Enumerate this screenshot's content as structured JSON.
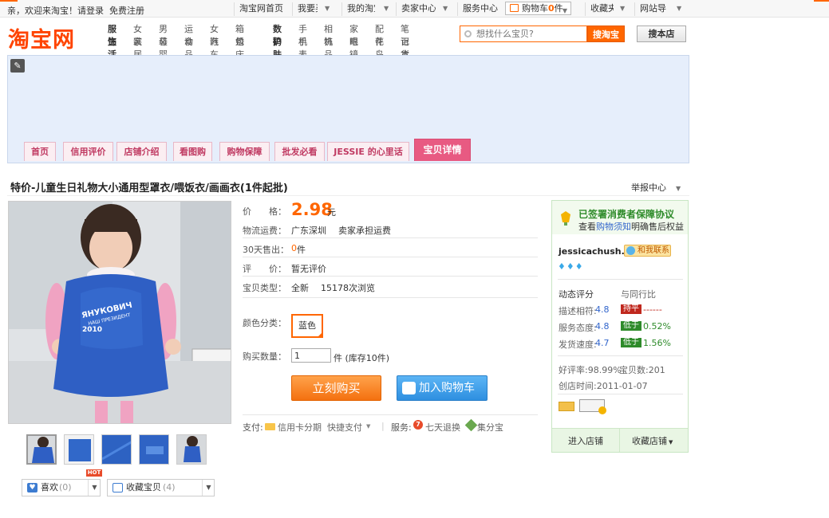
{
  "topbar": {
    "welcome": "亲，欢迎来淘宝！请",
    "login": "登录",
    "register": "免费注册",
    "items": [
      {
        "label": "淘宝网首页"
      },
      {
        "label": "我要买"
      },
      {
        "label": "我的淘宝"
      },
      {
        "label": "卖家中心"
      },
      {
        "label": "服务中心"
      },
      {
        "label": "收藏夹"
      },
      {
        "label": "网站导航"
      }
    ],
    "cart_label": "购物车",
    "cart_count": "0",
    "cart_unit": "件"
  },
  "header": {
    "logo": "淘宝网",
    "categories": {
      "col1_bold": [
        "服饰",
        "生活"
      ],
      "col_a": [
        "女装",
        "家居"
      ],
      "col_b": [
        "男装",
        "母婴"
      ],
      "col_c": [
        "运动",
        "食品"
      ],
      "col_d": [
        "女鞋",
        "汽车"
      ],
      "col_e": [
        "箱包",
        "婚庆"
      ],
      "col2_bold": [
        "数码",
        "护肤"
      ],
      "col_f": [
        "手机",
        "手表"
      ],
      "col_g": [
        "相机",
        "饰品"
      ],
      "col_h": [
        "家电",
        "眼镜"
      ],
      "col_i": [
        "配件",
        "花鸟"
      ],
      "col_j": [
        "笔记本",
        "百货"
      ]
    },
    "search_placeholder": "想找什么宝贝?",
    "search_taobao": "搜淘宝",
    "search_store": "搜本店"
  },
  "nav": {
    "tabs": [
      "首页",
      "信用评价",
      "店铺介绍",
      "看图购",
      "购物保障",
      "批发必看",
      "JESSIE 的心里话"
    ],
    "active": "宝贝详情"
  },
  "item": {
    "title": "特价-儿童生日礼物大小通用型罩衣/喂饭衣/画画衣(1件起批)",
    "report": "举报中心",
    "price_label": "价　　格：",
    "price": "2.98",
    "price_unit": "元",
    "shipping_label": "物流运费：",
    "shipping_from": "广东深圳",
    "shipping_note": "卖家承担运费",
    "sold_label": "30天售出：",
    "sold_count": "0",
    "sold_unit": "件",
    "rating_label": "评　　价：",
    "rating_value": "暂无评价",
    "type_label": "宝贝类型：",
    "type_value": "全新",
    "views": "15178次浏览",
    "color_label": "颜色分类：",
    "color_option": "蓝色",
    "qty_label": "购买数量：",
    "qty_value": "1",
    "stock": "件 (库存10件)",
    "buy_now": "立刻购买",
    "add_cart": "加入购物车",
    "pay_label": "支付:",
    "pay_credit": "信用卡分期",
    "pay_quick": "快捷支付",
    "service_label": "服务:",
    "service_return": "七天退换",
    "service_points": "集分宝",
    "photo_watermark": "ЯНУКОВИЧ",
    "photo_sub": "НАШ ПРЕЗИДЕНТ",
    "photo_year": "2010",
    "hot": "HOT",
    "like_label": "喜欢",
    "like_count": "(0)",
    "fav_label": "收藏宝贝",
    "fav_count": "(4)"
  },
  "seller": {
    "protocol": "已签署消费者保障协议",
    "protocol_sub_a": "查看",
    "protocol_sub_link": "购物须知",
    "protocol_sub_b": "明确售后权益",
    "name": "jessicachush...",
    "contact": "和我联系",
    "dsr_title": "动态评分",
    "dsr_compare": "与同行比",
    "dsr": [
      {
        "label": "描述相符:",
        "score": "4.8",
        "badge": "持平",
        "cmp": "------"
      },
      {
        "label": "服务态度:",
        "score": "4.8",
        "badge": "低于",
        "cmp": "0.52%"
      },
      {
        "label": "发货速度:",
        "score": "4.7",
        "badge": "低于",
        "cmp": "1.56%"
      }
    ],
    "good_rate": "好评率:98.99%",
    "item_count": "宝贝数:201",
    "created": "创店时间:2011-01-07",
    "enter_store": "进入店铺",
    "fav_store": "收藏店铺",
    "colors": {
      "badge_equal": "#c0281e",
      "badge_low": "#2e8b2a",
      "accent": "#f60"
    }
  }
}
